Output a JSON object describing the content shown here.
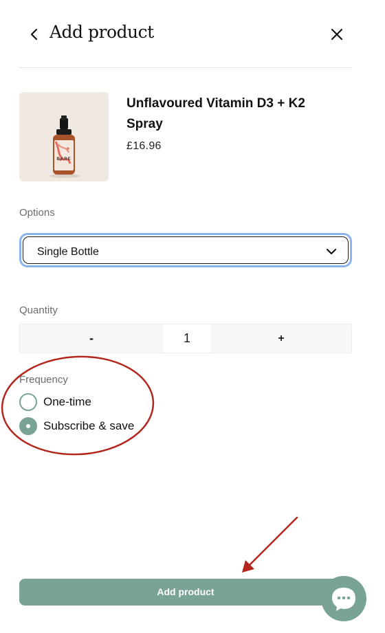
{
  "header": {
    "title": "Add product",
    "back_icon": "chevron-left-icon",
    "close_icon": "close-icon"
  },
  "product": {
    "name": "Unflavoured Vitamin D3 + K2 Spray",
    "price": "£16.96",
    "image_brand_text": "BARE"
  },
  "options": {
    "label": "Options",
    "selected": "Single Bottle"
  },
  "quantity": {
    "label": "Quantity",
    "minus": "-",
    "value": "1",
    "plus": "+"
  },
  "frequency": {
    "label": "Frequency",
    "items": [
      {
        "label": "One-time",
        "checked": false
      },
      {
        "label": "Subscribe & save",
        "checked": true
      }
    ]
  },
  "footer": {
    "add_label": "Add product",
    "chat_icon": "chat-bubble-icon"
  },
  "colors": {
    "accent": "#7aa397",
    "annotation": "#b3261e",
    "focus_ring": "#8ab4f0"
  }
}
